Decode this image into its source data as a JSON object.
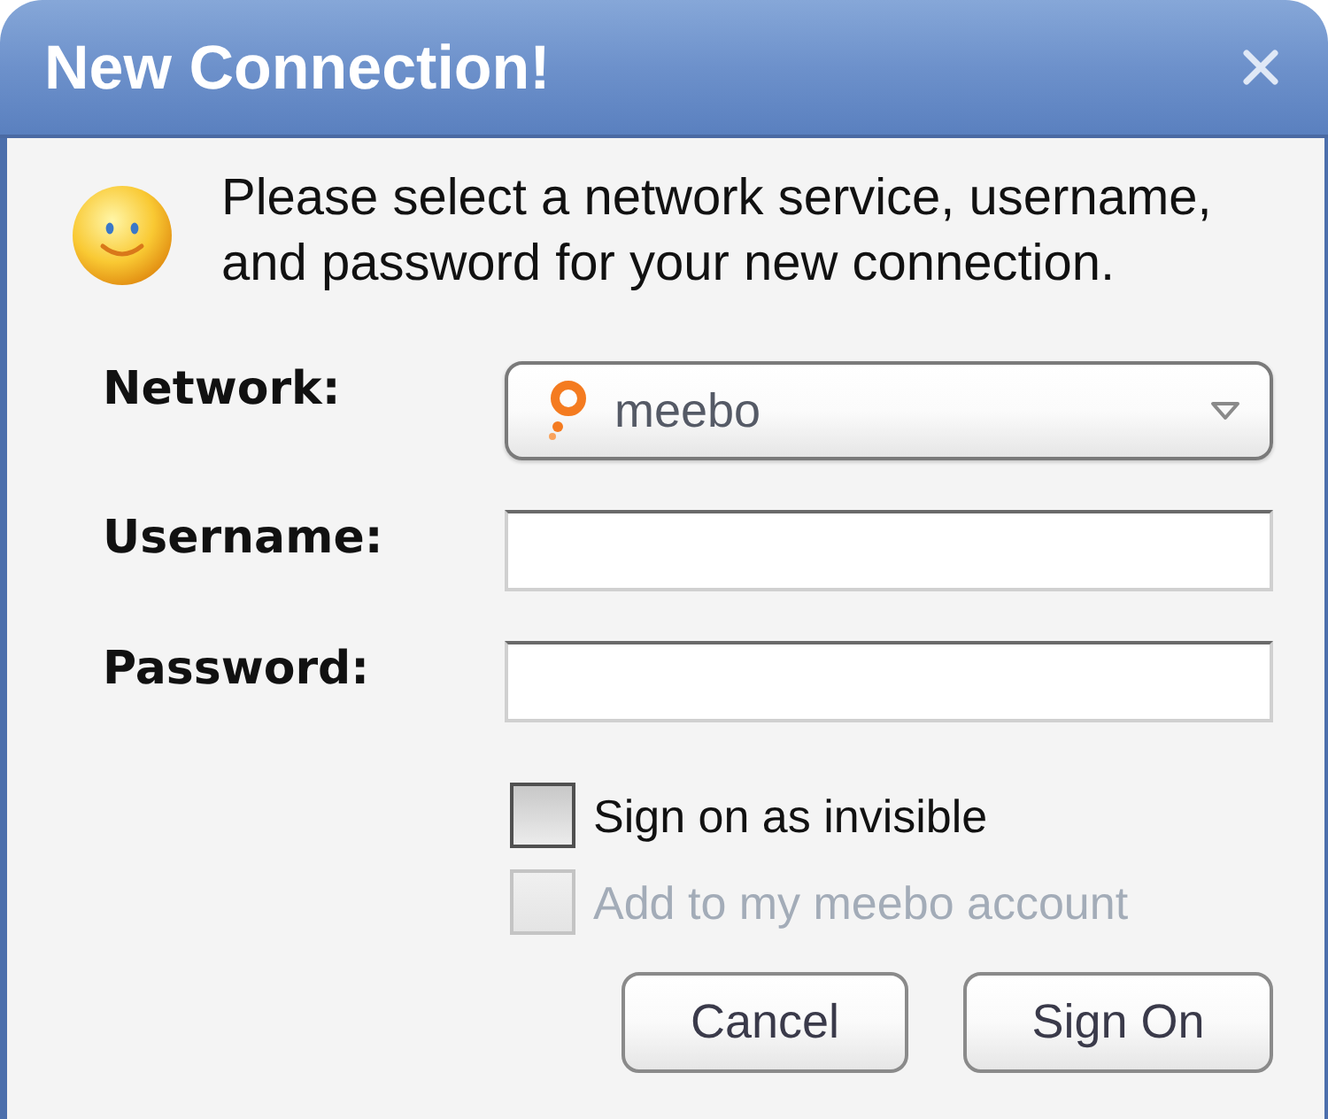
{
  "window": {
    "title": "New Connection!"
  },
  "message": "Please select a network service, username, and password for your new connection.",
  "fields": [
    {
      "kind": "select",
      "label": "Network:",
      "value": "meebo"
    },
    {
      "kind": "text",
      "label": "Username:"
    },
    {
      "kind": "password",
      "label": "Password:"
    }
  ],
  "options": [
    {
      "label": "Sign on as invisible",
      "checked": false,
      "disabled": false
    },
    {
      "label": "Add to my meebo account",
      "checked": false,
      "disabled": true
    }
  ],
  "buttons": [
    {
      "label": "Cancel"
    },
    {
      "label": "Sign On"
    }
  ]
}
